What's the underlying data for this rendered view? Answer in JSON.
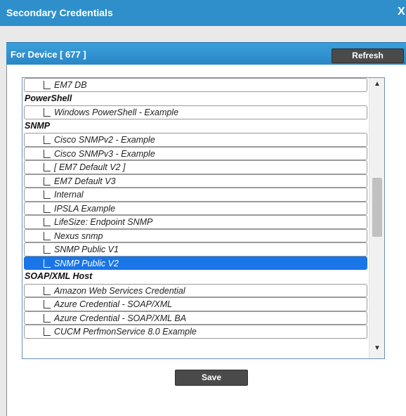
{
  "dialog": {
    "title": "Secondary Credentials",
    "close_glyph": "X"
  },
  "panel": {
    "title": "For Device [ 677 ]",
    "refresh_label": "Refresh"
  },
  "list": {
    "rows": [
      {
        "type": "item",
        "label": "EM7 DB"
      },
      {
        "type": "group",
        "label": "PowerShell"
      },
      {
        "type": "item",
        "label": "Windows PowerShell - Example"
      },
      {
        "type": "group",
        "label": "SNMP"
      },
      {
        "type": "item",
        "label": "Cisco SNMPv2 - Example"
      },
      {
        "type": "item",
        "label": "Cisco SNMPv3 - Example"
      },
      {
        "type": "item",
        "label": "[ EM7 Default V2 ]"
      },
      {
        "type": "item",
        "label": "EM7 Default V3"
      },
      {
        "type": "item",
        "label": "Internal"
      },
      {
        "type": "item",
        "label": "IPSLA Example"
      },
      {
        "type": "item",
        "label": "LifeSize: Endpoint SNMP"
      },
      {
        "type": "item",
        "label": "Nexus snmp"
      },
      {
        "type": "item",
        "label": "SNMP Public V1"
      },
      {
        "type": "item",
        "label": "SNMP Public V2",
        "selected": true
      },
      {
        "type": "group",
        "label": "SOAP/XML Host"
      },
      {
        "type": "item",
        "label": "Amazon Web Services Credential"
      },
      {
        "type": "item",
        "label": "Azure Credential - SOAP/XML"
      },
      {
        "type": "item",
        "label": "Azure Credential - SOAP/XML BA"
      },
      {
        "type": "item",
        "label": "CUCM PerfmonService 8.0 Example"
      }
    ],
    "scroll_up_glyph": "▲",
    "scroll_down_glyph": "▼"
  },
  "footer": {
    "save_label": "Save"
  },
  "colors": {
    "titlebar": "#2f8fcb",
    "panel_header": "#2a86c4",
    "selected_row": "#1a75e6",
    "button": "#4a4a4a"
  }
}
